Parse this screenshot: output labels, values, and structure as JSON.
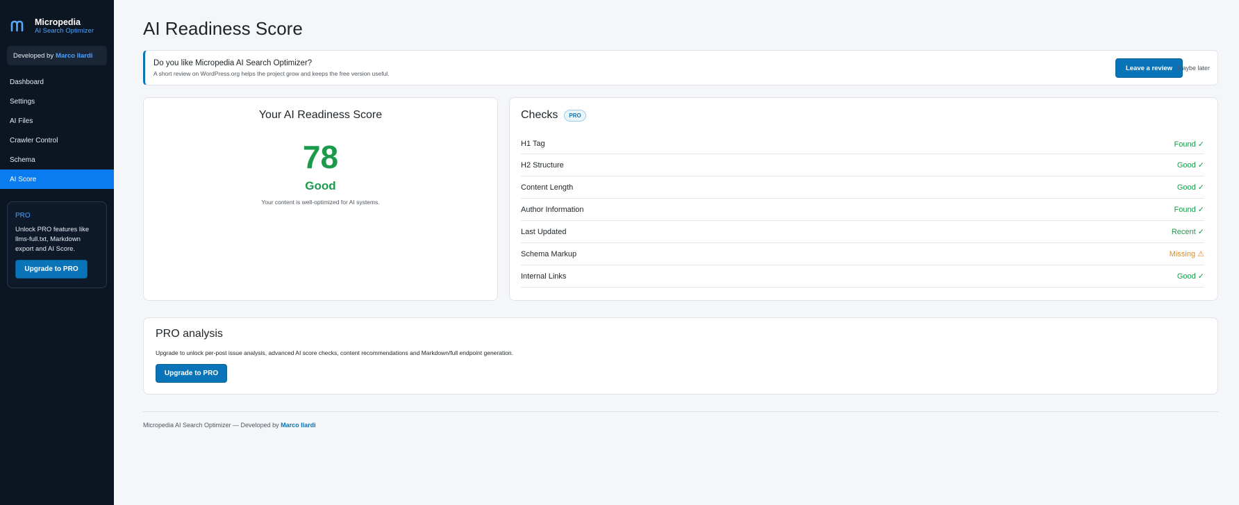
{
  "sidebar": {
    "brand": {
      "name": "Micropedia",
      "subtitle": "AI Search Optimizer",
      "logo_icon": "m-logo-icon"
    },
    "developed_by": {
      "prefix": "Developed by",
      "name": "Marco Ilardi"
    },
    "nav": [
      {
        "label": "Dashboard",
        "active": false
      },
      {
        "label": "Settings",
        "active": false
      },
      {
        "label": "AI Files",
        "active": false
      },
      {
        "label": "Crawler Control",
        "active": false
      },
      {
        "label": "Schema",
        "active": false
      },
      {
        "label": "AI Score",
        "active": true
      }
    ],
    "pro_card": {
      "title": "PRO",
      "text": "Unlock PRO features like llms-full.txt, Markdown export and AI Score.",
      "button": "Upgrade to PRO"
    }
  },
  "page": {
    "title": "AI Readiness Score"
  },
  "notice": {
    "title": "Do you like Micropedia AI Search Optimizer?",
    "text": "A short review on WordPress.org helps the project grow and keeps the free version useful.",
    "review_button": "Leave a review",
    "later_link": "Maybe later"
  },
  "score": {
    "title": "Your AI Readiness Score",
    "value": "78",
    "label": "Good",
    "description": "Your content is well-optimized for AI systems."
  },
  "checks": {
    "title": "Checks",
    "badge": "PRO",
    "items": [
      {
        "name": "H1 Tag",
        "status": "Found ✓",
        "level": "ok"
      },
      {
        "name": "H2 Structure",
        "status": "Good ✓",
        "level": "ok"
      },
      {
        "name": "Content Length",
        "status": "Good ✓",
        "level": "ok"
      },
      {
        "name": "Author Information",
        "status": "Found ✓",
        "level": "ok"
      },
      {
        "name": "Last Updated",
        "status": "Recent ✓",
        "level": "ok"
      },
      {
        "name": "Schema Markup",
        "status": "Missing ⚠",
        "level": "warn"
      },
      {
        "name": "Internal Links",
        "status": "Good ✓",
        "level": "ok"
      }
    ]
  },
  "pro_analysis": {
    "title": "PRO analysis",
    "text": "Upgrade to unlock per-post issue analysis, advanced AI score checks, content recommendations and Markdown/full endpoint generation.",
    "button": "Upgrade to PRO"
  },
  "footer": {
    "text": "Micropedia AI Search Optimizer — Developed by",
    "developer": "Marco Ilardi"
  },
  "colors": {
    "sidebar_bg": "#0c1623",
    "accent": "#0a74b8",
    "active_nav": "#0a7cf0",
    "success": "#1a9a4a",
    "warning": "#e08a1e"
  }
}
